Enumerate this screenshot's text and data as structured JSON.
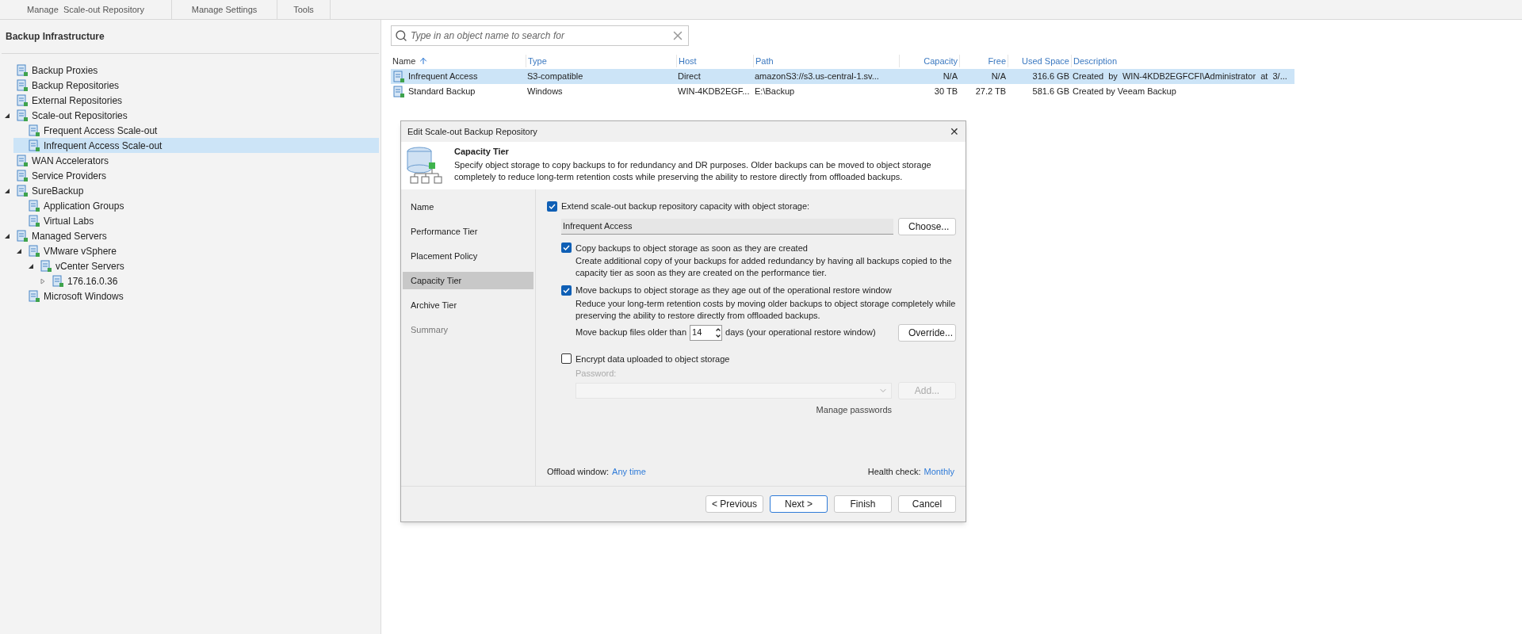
{
  "ribbon": {
    "groups": [
      "Manage  Scale-out Repository",
      "Manage Settings",
      "Tools"
    ]
  },
  "sidebar": {
    "title": "Backup Infrastructure",
    "tree": [
      {
        "label": "Backup Proxies",
        "selected": false
      },
      {
        "label": "Backup Repositories",
        "selected": false
      },
      {
        "label": "External Repositories",
        "selected": false
      },
      {
        "label": "Scale-out Repositories",
        "selected": false,
        "expanded": true,
        "children": [
          {
            "label": "Frequent Access Scale-out",
            "selected": false
          },
          {
            "label": "Infrequent Access Scale-out",
            "selected": true
          }
        ]
      },
      {
        "label": "WAN Accelerators",
        "selected": false
      },
      {
        "label": "Service Providers",
        "selected": false
      },
      {
        "label": "SureBackup",
        "selected": false,
        "expanded": true,
        "children": [
          {
            "label": "Application Groups",
            "selected": false
          },
          {
            "label": "Virtual Labs",
            "selected": false
          }
        ]
      },
      {
        "label": "Managed Servers",
        "selected": false,
        "expanded": true,
        "children": [
          {
            "label": "VMware vSphere",
            "selected": false,
            "expanded": true,
            "children": [
              {
                "label": "vCenter Servers",
                "selected": false,
                "expanded": true,
                "children": [
                  {
                    "label": "176.16.0.36",
                    "selected": false,
                    "expanded": false
                  }
                ]
              }
            ]
          },
          {
            "label": "Microsoft Windows",
            "selected": false
          }
        ]
      }
    ]
  },
  "search": {
    "placeholder": "Type in an object name to search for"
  },
  "table": {
    "columns": [
      {
        "label": "Name",
        "sorted": true
      },
      {
        "label": "Type",
        "sorted": false
      },
      {
        "label": "Host",
        "sorted": false
      },
      {
        "label": "Path",
        "sorted": false
      },
      {
        "label": "Capacity",
        "sorted": false
      },
      {
        "label": "Free",
        "sorted": false
      },
      {
        "label": "Used Space",
        "sorted": false
      },
      {
        "label": "Description",
        "sorted": false
      }
    ],
    "rows": [
      {
        "selected": true,
        "cells": [
          "Infrequent Access",
          "S3-compatible",
          "Direct",
          "amazonS3://s3.us-central-1.sv...",
          "N/A",
          "N/A",
          "316.6 GB",
          "Created  by  WIN-4KDB2EGFCFI\\Administrator  at  3/..."
        ]
      },
      {
        "selected": false,
        "cells": [
          "Standard Backup",
          "Windows",
          "WIN-4KDB2EGF...",
          "E:\\Backup",
          "30 TB",
          "27.2 TB",
          "581.6 GB",
          "Created by Veeam Backup"
        ]
      }
    ]
  },
  "dialog": {
    "title": "Edit Scale-out Backup Repository",
    "close": "✕",
    "header": {
      "title": "Capacity Tier",
      "description": "Specify object storage to copy backups to for redundancy and DR purposes. Older backups can be moved to object storage completely to reduce long-term retention costs while preserving the ability to restore directly from offloaded backups."
    },
    "steps": [
      {
        "label": "Name",
        "selected": false,
        "disabled": false
      },
      {
        "label": "Performance Tier",
        "selected": false,
        "disabled": false
      },
      {
        "label": "Placement Policy",
        "selected": false,
        "disabled": false
      },
      {
        "label": "Capacity Tier",
        "selected": true,
        "disabled": false
      },
      {
        "label": "Archive Tier",
        "selected": false,
        "disabled": false
      },
      {
        "label": "Summary",
        "selected": false,
        "disabled": true
      }
    ],
    "extend": {
      "label": "Extend scale-out backup repository capacity with object storage:",
      "checked": true,
      "value": "Infrequent Access",
      "button": "Choose..."
    },
    "copy": {
      "label": "Copy backups to object storage as soon as they are created",
      "checked": true,
      "description": "Create additional copy of your backups for added redundancy by having all backups copied to the capacity tier as soon as they are created on the performance tier."
    },
    "move": {
      "label": "Move backups to object storage as they age out of the operational restore window",
      "checked": true,
      "description": "Reduce your long-term retention costs by moving older backups to object storage completely while preserving the ability to restore directly from offloaded backups.",
      "prefix": "Move backup files older than",
      "days": "14",
      "suffix": "days (your operational restore window)",
      "button": "Override..."
    },
    "encrypt": {
      "label": "Encrypt data uploaded to object storage",
      "checked": false,
      "password_label": "Password:",
      "add": "Add...",
      "manage": "Manage passwords"
    },
    "offload": {
      "label": "Offload window:",
      "link": "Any time"
    },
    "health": {
      "label": "Health check:",
      "link": "Monthly"
    },
    "buttons": [
      {
        "label": "< Previous",
        "default": false
      },
      {
        "label": "Next >",
        "default": true
      },
      {
        "label": "Finish",
        "default": false
      },
      {
        "label": "Cancel",
        "default": false
      }
    ]
  }
}
